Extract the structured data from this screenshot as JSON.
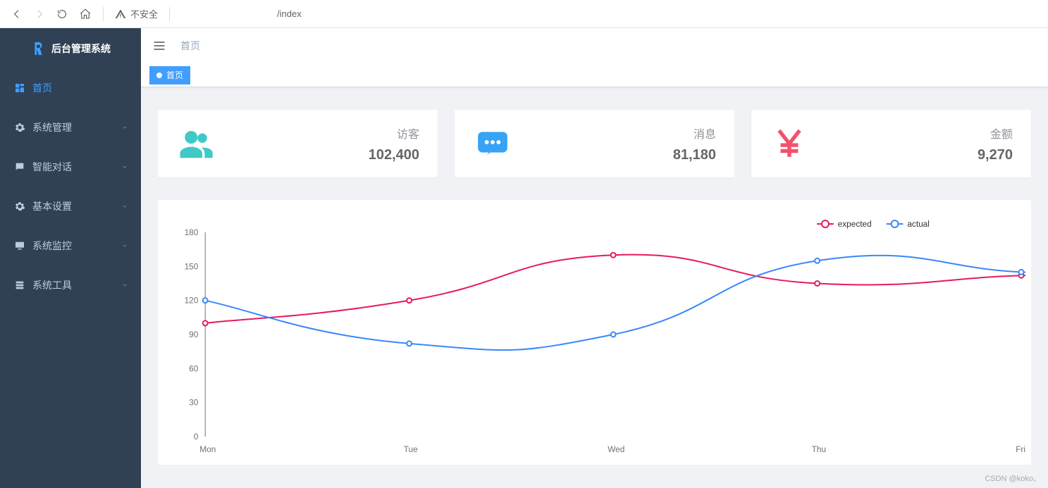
{
  "browser": {
    "insecure_label": "不安全",
    "url_suffix": "/index"
  },
  "brand": {
    "title": "后台管理系统"
  },
  "sidebar": {
    "items": [
      {
        "label": "首页",
        "icon": "dashboard",
        "active": true,
        "expandable": false
      },
      {
        "label": "系统管理",
        "icon": "gear",
        "active": false,
        "expandable": true
      },
      {
        "label": "智能对话",
        "icon": "chat",
        "active": false,
        "expandable": true
      },
      {
        "label": "基本设置",
        "icon": "gear",
        "active": false,
        "expandable": true
      },
      {
        "label": "系统监控",
        "icon": "monitor",
        "active": false,
        "expandable": true
      },
      {
        "label": "系统工具",
        "icon": "tool",
        "active": false,
        "expandable": true
      }
    ]
  },
  "breadcrumb": {
    "label": "首页"
  },
  "tag": {
    "label": "首页"
  },
  "cards": [
    {
      "label": "访客",
      "value": "102,400",
      "icon": "people",
      "color": "#40c9c6"
    },
    {
      "label": "消息",
      "value": "81,180",
      "icon": "message",
      "color": "#36a3f7"
    },
    {
      "label": "金额",
      "value": "9,270",
      "icon": "yen",
      "color": "#f4516c"
    }
  ],
  "chart_data": {
    "type": "line",
    "categories": [
      "Mon",
      "Tue",
      "Wed",
      "Thu",
      "Fri"
    ],
    "series": [
      {
        "name": "expected",
        "color": "#e6195e",
        "values": [
          100,
          120,
          160,
          135,
          142
        ]
      },
      {
        "name": "actual",
        "color": "#3888fa",
        "values": [
          120,
          82,
          90,
          155,
          145
        ]
      }
    ],
    "ylim": [
      0,
      180
    ],
    "ytick": 30,
    "grid": false,
    "legend_position": "top-right"
  },
  "watermark": "CSDN @koko、"
}
